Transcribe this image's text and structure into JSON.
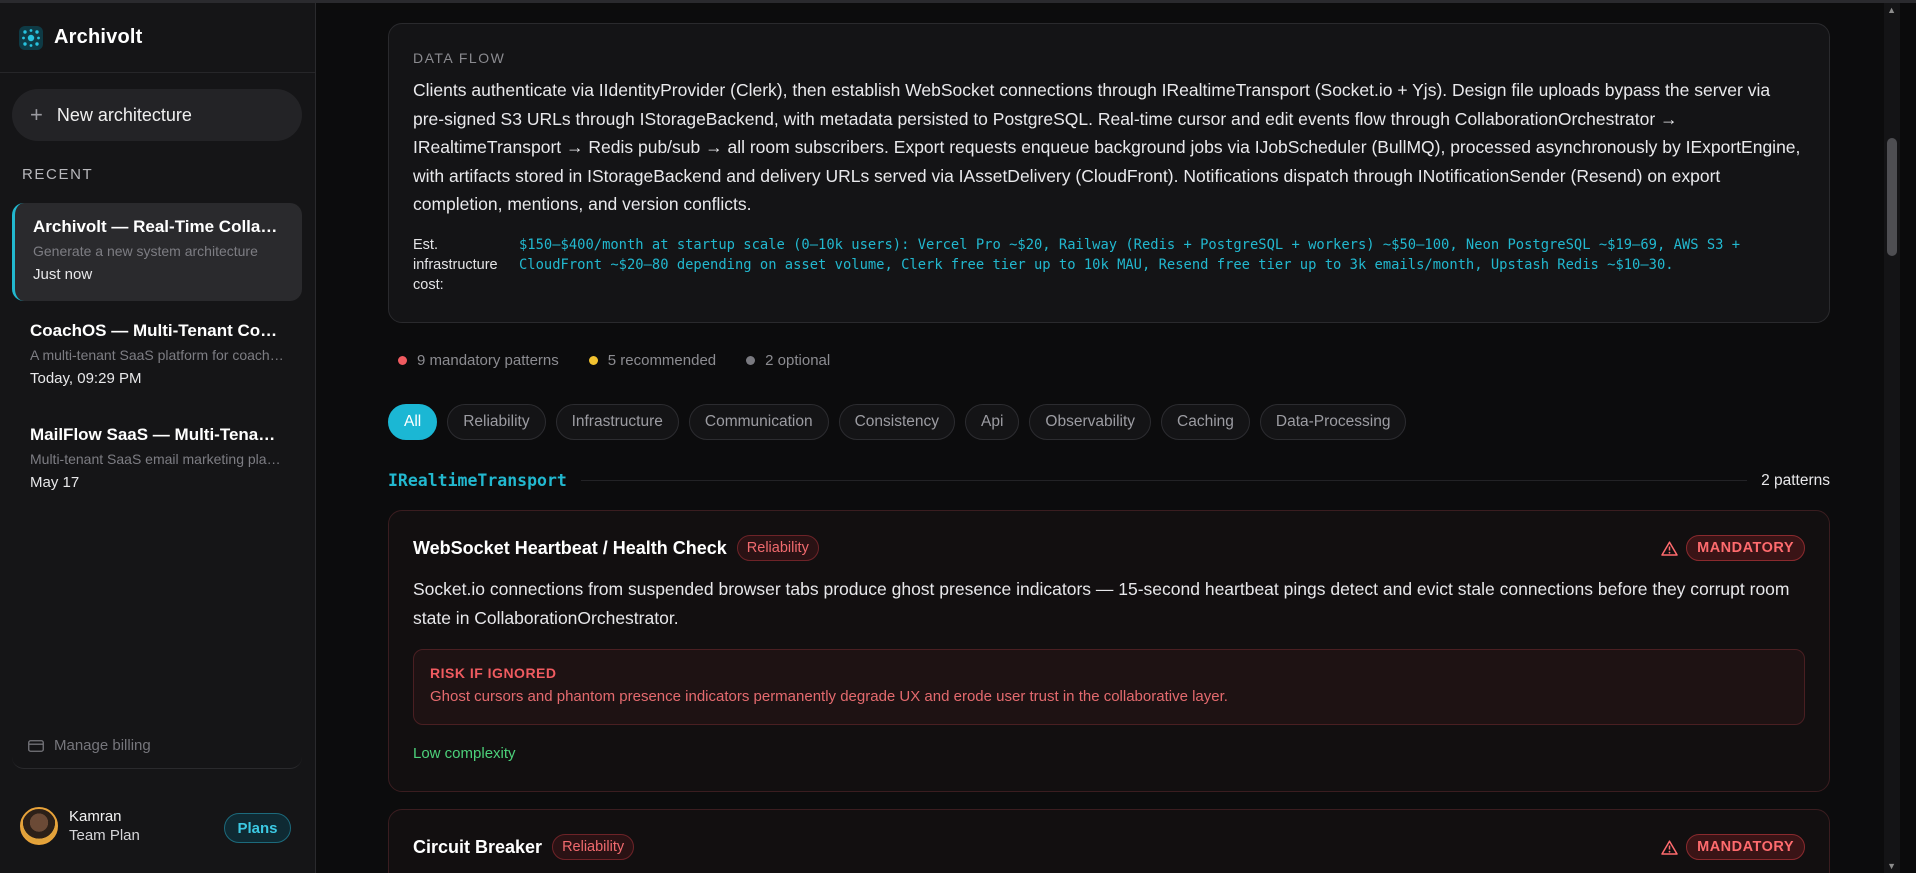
{
  "app": {
    "name": "Archivolt"
  },
  "sidebar": {
    "new_button": "New architecture",
    "recent_heading": "RECENT",
    "recent": [
      {
        "title": "Archivolt — Real-Time Collaborative Design Platform",
        "desc": "Generate a new system architecture",
        "time": "Just now"
      },
      {
        "title": "CoachOS — Multi-Tenant Coaching Platform",
        "desc": "A multi-tenant SaaS platform for coaches",
        "time": "Today, 09:29 PM"
      },
      {
        "title": "MailFlow SaaS — Multi-Tenant Email Marketing",
        "desc": "Multi-tenant SaaS email marketing platform",
        "time": "May 17"
      }
    ],
    "billing": "Manage billing",
    "user": {
      "name": "Kamran",
      "plan": "Team Plan"
    },
    "plans_button": "Plans"
  },
  "dataflow": {
    "label": "DATA FLOW",
    "text": "Clients authenticate via IIdentityProvider (Clerk), then establish WebSocket connections through IRealtimeTransport (Socket.io + Yjs). Design file uploads bypass the server via pre-signed S3 URLs through IStorageBackend, with metadata persisted to PostgreSQL. Real-time cursor and edit events flow through CollaborationOrchestrator → IRealtimeTransport → Redis pub/sub → all room subscribers. Export requests enqueue background jobs via IJobScheduler (BullMQ), processed asynchronously by IExportEngine, with artifacts stored in IStorageBackend and delivery URLs served via IAssetDelivery (CloudFront). Notifications dispatch through INotificationSender (Resend) on export completion, mentions, and version conflicts.",
    "cost_label": "Est. infrastructure cost:",
    "cost_value": "$150–$400/month at startup scale (0–10k users): Vercel Pro ~$20, Railway (Redis + PostgreSQL + workers) ~$50–100, Neon PostgreSQL ~$19–69, AWS S3 + CloudFront ~$20–80 depending on asset volume, Clerk free tier up to 10k MAU, Resend free tier up to 3k emails/month, Upstash Redis ~$10–30."
  },
  "counts": [
    {
      "text": "9 mandatory patterns",
      "color": "#f05b60"
    },
    {
      "text": "5 recommended",
      "color": "#f2c230"
    },
    {
      "text": "2 optional",
      "color": "#7a7a80"
    }
  ],
  "filters": [
    "All",
    "Reliability",
    "Infrastructure",
    "Communication",
    "Consistency",
    "Api",
    "Observability",
    "Caching",
    "Data-Processing"
  ],
  "group": {
    "name": "IRealtimeTransport",
    "count": "2 patterns"
  },
  "cards": [
    {
      "title": "WebSocket Heartbeat / Health Check",
      "tag": "Reliability",
      "priority": "MANDATORY",
      "text": "Socket.io connections from suspended browser tabs produce ghost presence indicators — 15-second heartbeat pings detect and evict stale connections before they corrupt room state in CollaborationOrchestrator.",
      "risk_label": "RISK IF IGNORED",
      "risk_text": "Ghost cursors and phantom presence indicators permanently degrade UX and erode user trust in the collaborative layer.",
      "complexity": "Low complexity"
    },
    {
      "title": "Circuit Breaker",
      "tag": "Reliability",
      "priority": "MANDATORY"
    }
  ]
}
